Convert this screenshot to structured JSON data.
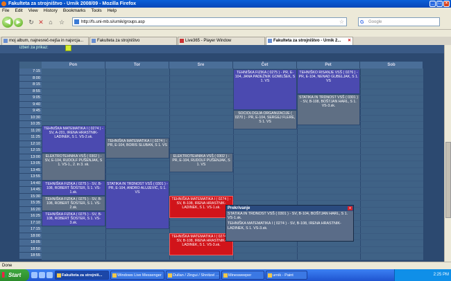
{
  "window": {
    "title": "Fakulteta za strojništvo - Urnik 2008/09 - Mozilla Firefox"
  },
  "menu": [
    "File",
    "Edit",
    "View",
    "History",
    "Bookmarks",
    "Tools",
    "Help"
  ],
  "nav": {
    "url": "http://fs.uni-mb.si/urnik/groups.asp",
    "search_placeholder": "Google"
  },
  "tabs": [
    {
      "label": "moj album, najnesreč-nejša in najsrcja..."
    },
    {
      "label": "Fakulteta za strojništvo"
    },
    {
      "label": "Live365 - Player Window"
    },
    {
      "label": "Fakulteta za strojništvo - Urnik 2..."
    }
  ],
  "page_top_text": "izberi za prikaz:",
  "days": [
    "Pon",
    "Tor",
    "Sre",
    "Čet",
    "Pet",
    "Sob"
  ],
  "times": [
    "7:15",
    "8:00",
    "8:45",
    "9:30",
    "10:15",
    "11:00",
    "11:45",
    "12:30",
    "13:15",
    "14:00",
    "14:45",
    "15:30",
    "16:15",
    "17:00",
    "17:45",
    "18:30",
    "19:15",
    "20:00",
    "20:45",
    "21:30",
    "22:15",
    "23:00",
    "8:00",
    "8:50",
    "9:40",
    "10:30",
    "11:20",
    "12:10",
    "13:00",
    "13:50",
    "14:40",
    "15:30",
    "16:20",
    "17:10",
    "18:00",
    "18:50",
    "19:40",
    "20:30"
  ],
  "time_labels": [
    "7:15",
    "8:00",
    "8:15",
    "8:55",
    "9:05",
    "9:40",
    "9:45",
    "10:30",
    "10:35",
    "11:20",
    "11:25",
    "12:10",
    "12:15",
    "13:00",
    "13:05",
    "13:45",
    "13:55",
    "14:40",
    "14:45",
    "15:30",
    "15:35",
    "16:20",
    "16:25",
    "17:10",
    "17:15",
    "18:00",
    "18:05",
    "18:50",
    "18:55"
  ],
  "events": [
    {
      "text": "TEHNIŠKA FIZIKA ( 0275 ) - PR, E-104, JANA PADEŽNIK GOMILŠEK, S 1. VS"
    },
    {
      "text": "TEHNIŠKO RISANJE VSŠ ( 0276 ) - PR, E-104, NENAD GUBELJAK, S 1. VS"
    },
    {
      "text": "STATIKA IN TRDNOST VSŠ ( 0301 ) - SV, B-108, BOŠTJAN HARL, S 1. VS-3.sk."
    },
    {
      "text": "SOCIOLOGIJA ORGANIZACIJE ( 0270 ) - PR, E-104, SERGEJ FLERE, S 1. VS"
    },
    {
      "text": "TEHNIŠKA MATEMATIKA I ( 0274 ) - SV, A-201, IRENA HRASTNIK-LADINEK, S 1. VS-2.sk."
    },
    {
      "text": "TEHNIŠKA MATEMATIKA I ( 0274 ) - PR, E-104, BORIS SLUBAN, S 1. VS"
    },
    {
      "text": "ELEKTROTEHNIKA VSŠ ( 0302 ) - SV, E-104, RUDOLF PUŠENJAK, S 1. VS-1., 2. in 3. sk."
    },
    {
      "text": "ELEKTROTEHNIKA VSŠ ( 0302 ) - PR, E-104, RUDOLF PUŠENJAK, S 1. VS"
    },
    {
      "text": "TEHNIŠKA FIZIKA ( 0275 ) - SV, B-108, ROBERT ŠOSTER, S 1. VS-1.sk."
    },
    {
      "text": "STATIKA IN TRDNOST VSŠ ( 0301 ) - PR, E-104, ANDRO ALUJEVIĆ, S 1. VS"
    },
    {
      "text": "TEHNIŠKA FIZIKA ( 0275 ) - SV, B-108, ROBERT ŠOSTER, S 1. VS-2.sk."
    },
    {
      "text": "TEHNIŠKA MATEMATIKA I ( 0274 ) - SV, B-108, IRENA HRASTNIK-LADINEK, S 1. VS-1.sk."
    },
    {
      "text": "TEHNIŠKA FIZIKA ( 0275 ) - SV, B-108, ROBERT ŠOSTER, S 1. VS-3.sk."
    },
    {
      "text": "TEHNIŠKA MATEMATIKA I ( 0274 ) - SV, B-108, IRENA HRASTNIK-LADINEK, S 1. VS-3.sk."
    }
  ],
  "popup": {
    "title": "Prekrivanje",
    "close": "x",
    "line1": "STATIKA IN TRDNOST VSŠ ( 0301 ) - SV, B-104, BOŠTJAN HARL, S 1. VS-1.sk.",
    "line2": "TEHNIŠKA MATEMATIKA I ( 0274 ) - SV, B-108, IRENA HRASTNIK-LADINEK, S 1. VS-3.sk."
  },
  "status": "Done",
  "taskbar": {
    "start": "Start",
    "items": [
      "Fakulteta za strojniš...",
      "Windows Live Messenger",
      "Dullan / Zingui / Shnitzel ...",
      "Minesweeper",
      "urnik - Paint"
    ],
    "clock": "2:25 PM"
  }
}
